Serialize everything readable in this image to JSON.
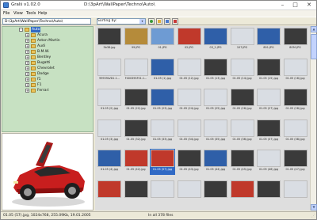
{
  "window": {
    "title": "Gralš v1.02.0",
    "path_title": "D:\\3pArt\\WallPaper\\Techno\\Auto\\",
    "minimize": "–",
    "maximize": "□",
    "close": "✕"
  },
  "menu": [
    "File",
    "View",
    "Tools",
    "Help"
  ],
  "toolbar": {
    "path_value": "D:\\3pArt\\WallPaper\\Techno\\Auto\\",
    "sort_label": "Sorting by:",
    "sort_arrow": "▾",
    "buttons": [
      "refresh-icon",
      "folder-icon",
      "image-icon",
      "delete-icon"
    ]
  },
  "tree": {
    "root": "Auto",
    "items": [
      "Acura",
      "Aston Martin",
      "Audi",
      "B.M.W.",
      "Bentley",
      "Bugatti",
      "Chevrolet",
      "Dodge",
      "f1",
      "F1",
      "Ferrari"
    ]
  },
  "thumbnails": {
    "captions_row1": [
      "5b38.jpg",
      "99.JPG",
      "01.JPG",
      "02.JPG",
      "03_2.JPG",
      "107.JPG",
      "801.JPG",
      "8OM.JPG"
    ],
    "captions_row2": [
      "99939LVD1.1...",
      "F40039SF01.1...",
      "01.05 (1).jpg",
      "01.05 (12).jpg",
      "01.05 (13).jpg",
      "01.05 (14).jpg",
      "01.05 (15).jpg",
      "01.05 (16).jpg"
    ],
    "captions_row3": [
      "01.05 (2).jpg",
      "01.05 (22).jpg",
      "01.05 (23).jpg",
      "01.05 (24).jpg",
      "01.05 (25).jpg",
      "01.05 (26).jpg",
      "01.05 (27).jpg",
      "01.05 (28).jpg"
    ],
    "captions_row4": [
      "01.05 (3).jpg",
      "01.05 (32).jpg",
      "01.05 (33).jpg",
      "01.05 (34).jpg",
      "01.05 (35).jpg",
      "01.05 (36).jpg",
      "01.05 (37).jpg",
      "01.05 (38).jpg"
    ],
    "captions_row5": [
      "01.05 (4).jpg",
      "01.05 (42).jpg",
      "01.05 (57).jpg",
      "01.05 (43).jpg",
      "01.05 (44).jpg",
      "01.05 (45).jpg",
      "01.05 (46).jpg",
      "01.05 (47).jpg"
    ],
    "captions_row6": [
      "",
      "",
      "",
      "",
      "",
      "",
      "",
      ""
    ],
    "colors": {
      "dark": "#3a3a3a",
      "blue": "#2f5fa8",
      "red": "#c0392b",
      "light": "#d9dde3",
      "gold": "#b58b3a",
      "sky": "#6e9bd3"
    }
  },
  "status": {
    "left": "01.05 (57).jpg, 1024x768, 255.09Kb, 19.01.2005",
    "mid": "In all 378 files"
  }
}
